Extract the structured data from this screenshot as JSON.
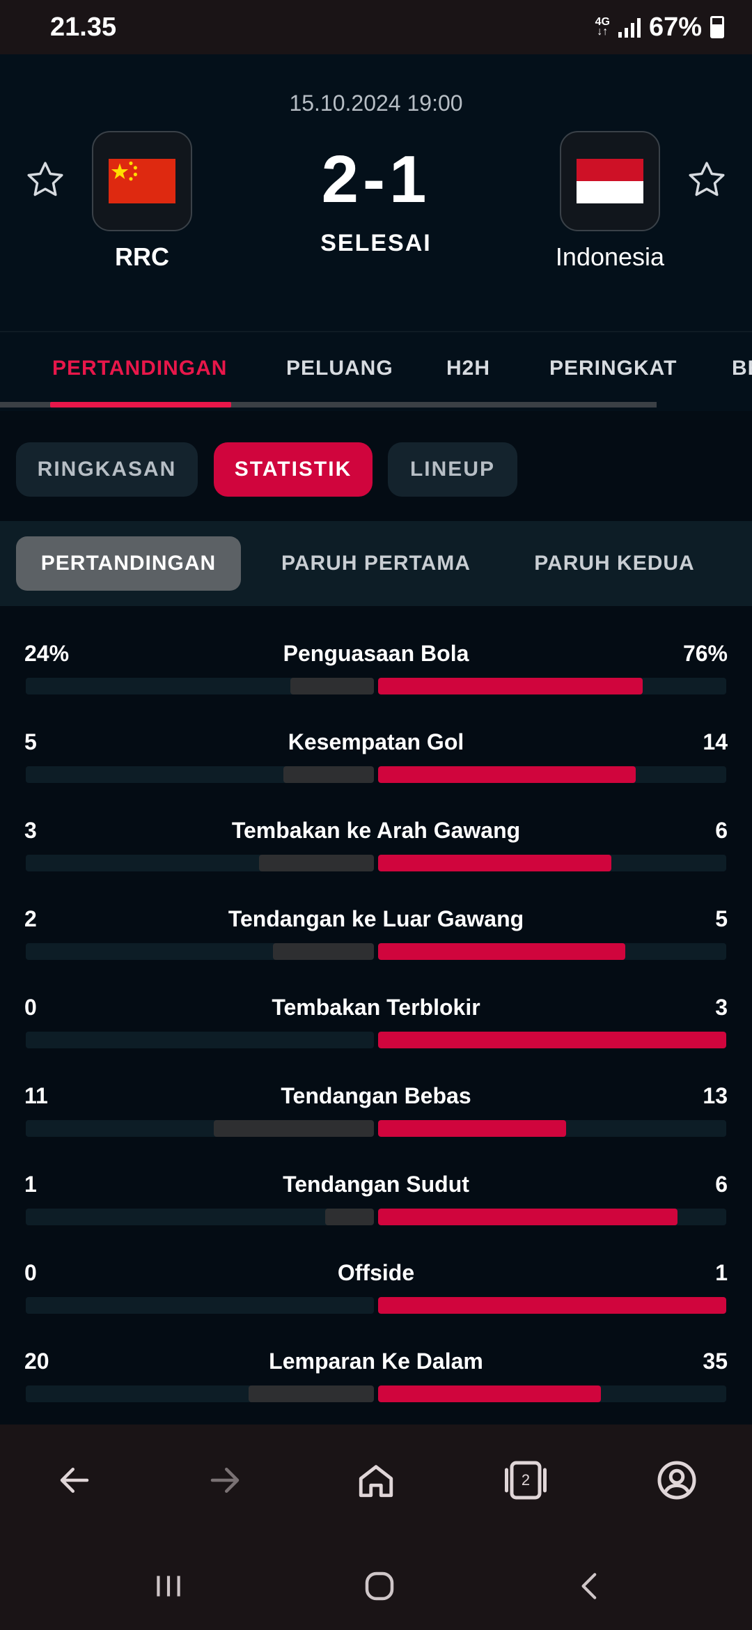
{
  "status_bar": {
    "time": "21.35",
    "network": "4G",
    "battery": "67%"
  },
  "match": {
    "datetime": "15.10.2024 19:00",
    "score": "2-1",
    "status": "SELESAI",
    "home": {
      "name": "RRC",
      "flag": "china-flag-icon"
    },
    "away": {
      "name": "Indonesia",
      "flag": "indonesia-flag-icon"
    }
  },
  "main_tabs": [
    "PERTANDINGAN",
    "PELUANG",
    "H2H",
    "PERINGKAT",
    "BE"
  ],
  "sub_tabs": [
    "RINGKASAN",
    "STATISTIK",
    "LINEUP"
  ],
  "period_tabs": [
    "PERTANDINGAN",
    "PARUH PERTAMA",
    "PARUH KEDUA"
  ],
  "stats": [
    {
      "label": "Penguasaan Bola",
      "home": "24%",
      "away": "76%",
      "home_frac": 0.24,
      "away_frac": 0.76
    },
    {
      "label": "Kesempatan Gol",
      "home": "5",
      "away": "14",
      "home_frac": 0.26,
      "away_frac": 0.74
    },
    {
      "label": "Tembakan ke Arah Gawang",
      "home": "3",
      "away": "6",
      "home_frac": 0.33,
      "away_frac": 0.67
    },
    {
      "label": "Tendangan ke Luar Gawang",
      "home": "2",
      "away": "5",
      "home_frac": 0.29,
      "away_frac": 0.71
    },
    {
      "label": "Tembakan Terblokir",
      "home": "0",
      "away": "3",
      "home_frac": 0.0,
      "away_frac": 1.0
    },
    {
      "label": "Tendangan Bebas",
      "home": "11",
      "away": "13",
      "home_frac": 0.46,
      "away_frac": 0.54
    },
    {
      "label": "Tendangan Sudut",
      "home": "1",
      "away": "6",
      "home_frac": 0.14,
      "away_frac": 0.86
    },
    {
      "label": "Offside",
      "home": "0",
      "away": "1",
      "home_frac": 0.0,
      "away_frac": 1.0
    },
    {
      "label": "Lemparan Ke Dalam",
      "home": "20",
      "away": "35",
      "home_frac": 0.36,
      "away_frac": 0.64
    }
  ],
  "browser_nav": {
    "tab_count": "2"
  },
  "colors": {
    "accent": "#e8174a",
    "bar_home": "#2e2f31",
    "bar_away": "#d0053d"
  }
}
